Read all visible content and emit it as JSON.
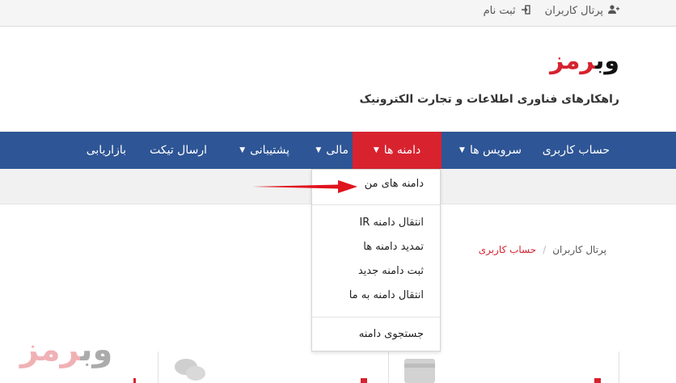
{
  "topbar": {
    "portal_label": "پرتال کاربران",
    "register_label": "ثبت نام",
    "icons": [
      "user-plus-icon",
      "sign-in-icon"
    ]
  },
  "header": {
    "logo_part1": "وب",
    "logo_part2": "رمز",
    "tagline": "راهکارهای فناوری اطلاعات و تجارت الکترونیک"
  },
  "nav": {
    "items": [
      {
        "label": "حساب کاربری",
        "has_caret": false
      },
      {
        "label": "سرویس ها",
        "has_caret": true
      },
      {
        "label": "دامنه ها",
        "has_caret": true,
        "active": true
      },
      {
        "label": "مالی",
        "has_caret": true
      },
      {
        "label": "پشتیبانی",
        "has_caret": true
      },
      {
        "label": "ارسال تیکت",
        "has_caret": false
      },
      {
        "label": "بازاریابی",
        "has_caret": false
      }
    ]
  },
  "dropdown": {
    "items": [
      {
        "label": "دامنه های من"
      },
      {
        "label": "انتقال دامنه IR"
      },
      {
        "label": "تمدید دامنه ها"
      },
      {
        "label": "ثبت دامنه جدید"
      },
      {
        "label": "انتقال دامنه به ما"
      },
      {
        "label": "جستجوی دامنه"
      }
    ]
  },
  "breadcrumb": {
    "home": "پرتال کاربران",
    "separator": "/",
    "current": "حساب کاربری"
  },
  "colors": {
    "nav_bg": "#2e5595",
    "active_bg": "#d8232f",
    "accent": "#d5232f",
    "arrow": "#e0141e"
  }
}
